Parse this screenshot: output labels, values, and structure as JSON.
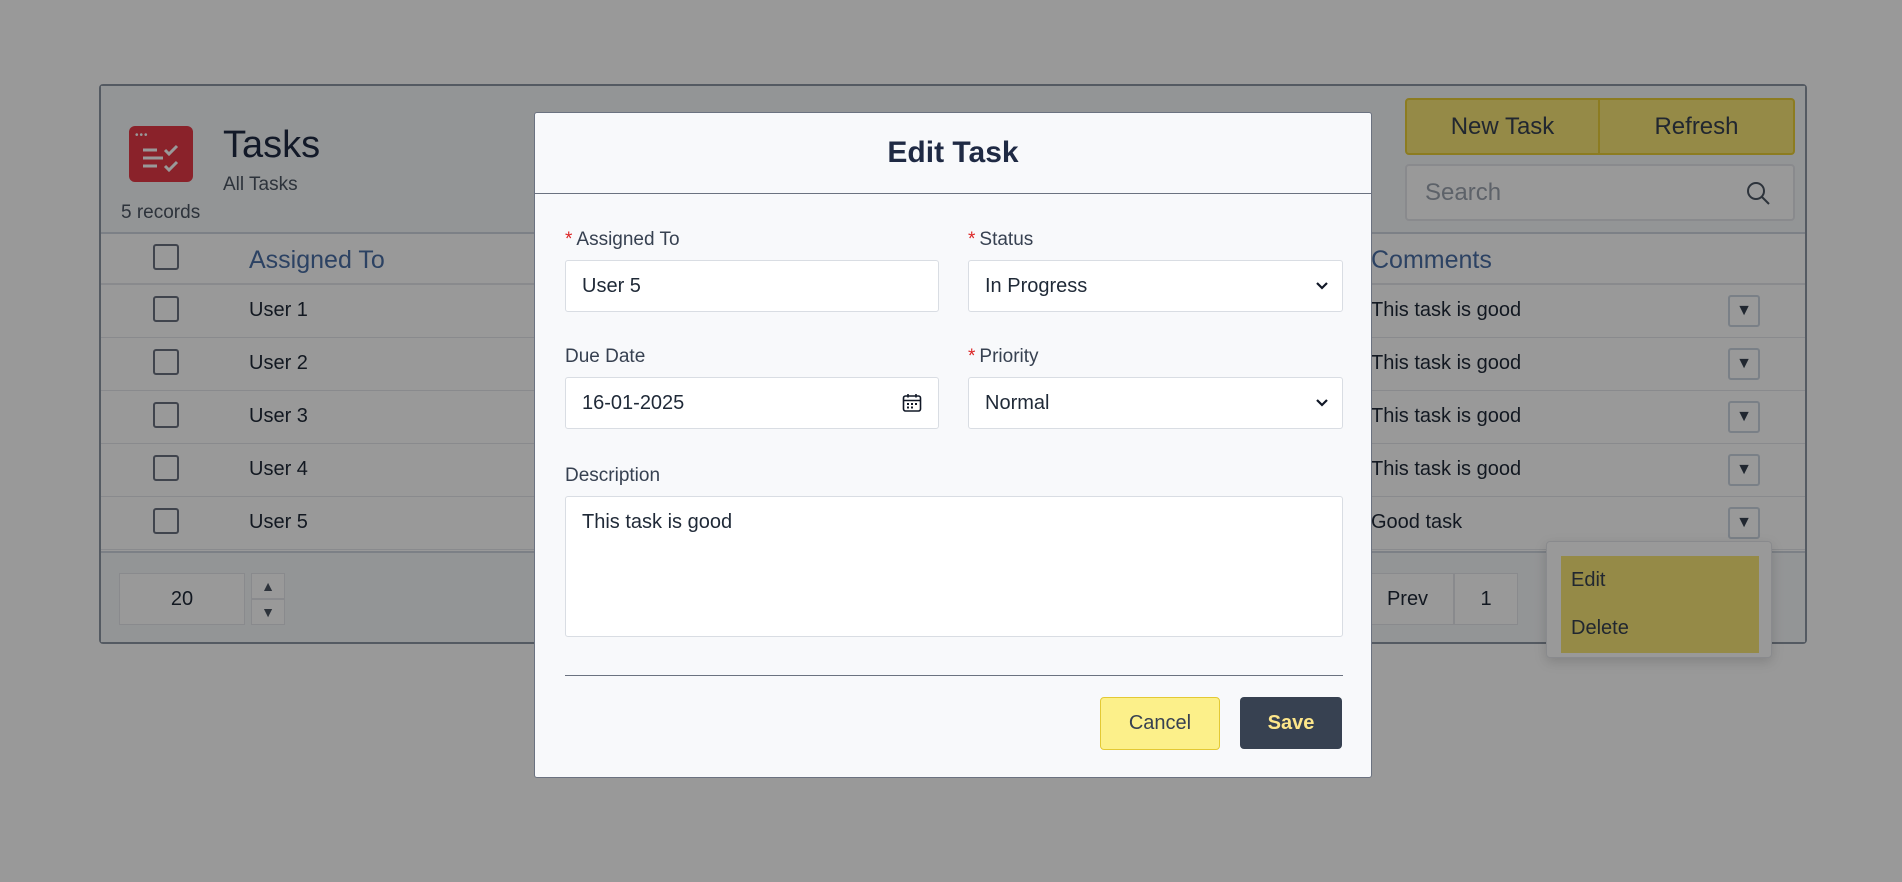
{
  "page": {
    "title": "Tasks",
    "subtitle": "All Tasks",
    "record_count": "5 records",
    "new_task_label": "New Task",
    "refresh_label": "Refresh",
    "search_placeholder": "Search"
  },
  "grid": {
    "columns": {
      "assigned_to": "Assigned To",
      "comments": "Comments"
    },
    "rows": [
      {
        "assigned_to": "User 1",
        "comments": "This task is good"
      },
      {
        "assigned_to": "User 2",
        "comments": "This task is good"
      },
      {
        "assigned_to": "User 3",
        "comments": "This task is good"
      },
      {
        "assigned_to": "User 4",
        "comments": "This task is good"
      },
      {
        "assigned_to": "User 5",
        "comments": "Good task"
      }
    ],
    "row_menu_icon": "▼"
  },
  "pagination": {
    "page_size": "20",
    "prev_label": "Prev",
    "current_page": "1"
  },
  "row_menu": {
    "edit_label": "Edit",
    "delete_label": "Delete"
  },
  "modal": {
    "title": "Edit Task",
    "assigned_to_label": "Assigned To",
    "assigned_to_value": "User 5",
    "status_label": "Status",
    "status_value": "In Progress",
    "due_date_label": "Due Date",
    "due_date_value": "16-01-2025",
    "priority_label": "Priority",
    "priority_value": "Normal",
    "description_label": "Description",
    "description_value": "This task is good",
    "required_marker": "*",
    "cancel_label": "Cancel",
    "save_label": "Save"
  },
  "colors": {
    "accent_yellow": "#f9e777",
    "dark_button": "#374151",
    "logo_red": "#e63946",
    "required_red": "#dc2626"
  },
  "icons": {
    "logo": "task-list-icon",
    "search": "search-icon",
    "calendar": "calendar-icon",
    "select": "chevron-down-icon"
  }
}
